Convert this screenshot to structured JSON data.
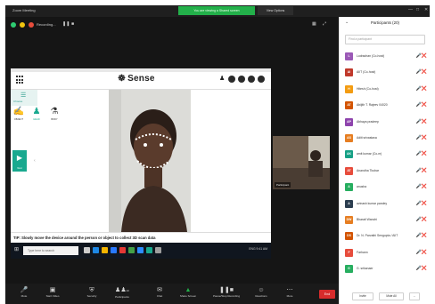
{
  "titlebar": {
    "app_title": "Zoom Meeting",
    "share_banner": "You are viewing a Shared screen",
    "view_options": "View Options"
  },
  "stage": {
    "recording_label": "Recording..."
  },
  "sense_app": {
    "logo_text": "Sense",
    "side_panel_label": "Choose",
    "modes": [
      {
        "icon": "wand-icon",
        "label": "OBJECT"
      },
      {
        "icon": "person-icon",
        "label": "HEAD"
      },
      {
        "icon": "body-icon",
        "label": "BODY"
      }
    ],
    "next_label": "Next",
    "tip": "TIP: Slowly move the device around the person or object to collect 3D scan data"
  },
  "taskbar": {
    "search_placeholder": "Type here to search",
    "tray_text": "ENG   9:41 AM"
  },
  "video_tile": {
    "name": "Participant"
  },
  "toolbar": {
    "items": [
      {
        "icon": "mic-icon",
        "label": "Mute"
      },
      {
        "icon": "video-icon",
        "label": "Start Video"
      },
      {
        "icon": "shield-icon",
        "label": "Security"
      },
      {
        "icon": "participants-icon",
        "label": "Participants",
        "count": "20"
      },
      {
        "icon": "chat-icon",
        "label": "Chat"
      },
      {
        "icon": "share-icon",
        "label": "Share Screen"
      },
      {
        "icon": "record-icon",
        "label": "Pause/Stop Recording"
      },
      {
        "icon": "reactions-icon",
        "label": "Reactions"
      },
      {
        "icon": "more-icon",
        "label": "More"
      }
    ],
    "end_label": "End",
    "accent_share": "#23b04a",
    "end_color": "#d62c2c"
  },
  "participants": {
    "title": "Participants (20)",
    "search_placeholder": "Find a participant",
    "rows": [
      {
        "initials": "L",
        "color": "#9b59b6",
        "name": "Lodrachan (Co-host)"
      },
      {
        "initials": "AI",
        "color": "#c0392b",
        "name": "AIIT (Co-host)"
      },
      {
        "initials": "H",
        "color": "#f39c12",
        "name": "Hitesh (Co-host)"
      },
      {
        "initials": "AT",
        "color": "#d35400",
        "name": "Abijith T. Rajeev 04020"
      },
      {
        "initials": "AP",
        "color": "#8e44ad",
        "name": "Abhaya pradeep"
      },
      {
        "initials": "AS",
        "color": "#e67e22",
        "name": "Aditi srivastava"
      },
      {
        "initials": "AK",
        "color": "#16a085",
        "name": "amit kumar (Co-m)"
      },
      {
        "initials": "AT",
        "color": "#e74c3c",
        "name": "Anandha Tkubar"
      },
      {
        "initials": "A",
        "color": "#27ae60",
        "name": "anusha"
      },
      {
        "initials": "A",
        "color": "#2c3e50",
        "name": "avinash kumar pandey"
      },
      {
        "initials": "DW",
        "color": "#e67e22",
        "name": "Bharati Wanohi"
      },
      {
        "initials": "DS",
        "color": "#d35400",
        "name": "Dr. N. Parvathi Sengupta / AIIT"
      },
      {
        "initials": "F",
        "color": "#e74c3c",
        "name": "Farhann"
      },
      {
        "initials": "G",
        "color": "#27ae60",
        "name": "G. srikanaer"
      }
    ],
    "footer": {
      "invite": "Invite",
      "mute_all": "Mute All",
      "more": "..."
    }
  }
}
